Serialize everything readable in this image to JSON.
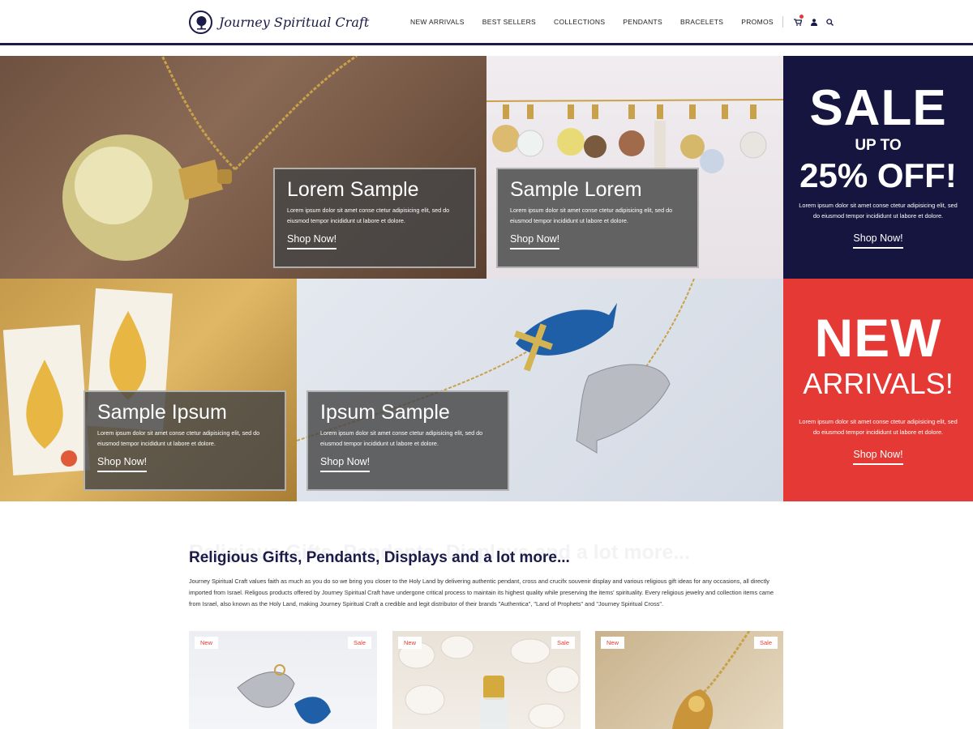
{
  "brand": {
    "name": "Journey Spiritual Craft"
  },
  "nav": {
    "items": [
      "NEW ARRIVALS",
      "BEST SELLERS",
      "COLLECTIONS",
      "PENDANTS",
      "BRACELETS",
      "PROMOS"
    ],
    "icons": [
      "cart-icon",
      "user-icon",
      "search-icon"
    ]
  },
  "banners": [
    {
      "title": "Lorem Sample",
      "text": "Lorem ipsum dolor sit amet conse ctetur adipisicing elit, sed do eiusmod tempor incididunt ut labore et dolore.",
      "link": "Shop Now!"
    },
    {
      "title": "Sample Lorem",
      "text": "Lorem ipsum dolor sit amet conse ctetur adipisicing elit, sed do eiusmod tempor incididunt ut labore et dolore.",
      "link": "Shop Now!"
    },
    {
      "title": "Sample Ipsum",
      "text": "Lorem ipsum dolor sit amet conse ctetur adipisicing elit, sed do eiusmod tempor incididunt ut labore et dolore.",
      "link": "Shop Now!"
    },
    {
      "title": "Ipsum Sample",
      "text": "Lorem ipsum dolor sit amet conse ctetur adipisicing elit, sed do eiusmod tempor incididunt ut labore et dolore.",
      "link": "Shop Now!"
    }
  ],
  "sale_promo": {
    "big": "SALE",
    "mid": "UP TO",
    "pct": "25% OFF!",
    "text": "Lorem ipsum dolor sit amet conse ctetur adipisicing elit, sed do eiusmod tempor incididunt ut labore et dolore.",
    "link": "Shop Now!",
    "color": "#15153f"
  },
  "new_promo": {
    "big": "NEW",
    "mid": "ARRIVALS!",
    "text": "Lorem ipsum dolor sit amet conse ctetur adipisicing elit, sed do eiusmod tempor incididunt ut labore et dolore.",
    "link": "Shop Now!",
    "color": "#e53935"
  },
  "intro": {
    "title": "Religious Gifts, Pendants, Displays and a lot more...",
    "text": "Journey Spiritual Craft values faith as much as you do so we bring you closer to the Holy Land by delivering authentic pendant, cross and crucifx souvenir display and various religious gift ideas for any occasions, all directly imported from Israel. Religous products offered by Journey Spiritual Craft have undergone critical process to maintain its highest quality while preserving the items' spirituality. Every religious jewelry and collection items came from Israel, also known as the Holy Land, making Journey Spiritual Craft a credible and legit distributor of their brands \"Authentica\", \"Land of Prophets\" and \"Journey Spiritual Cross\"."
  },
  "products": [
    {
      "badge_new": "New",
      "badge_sale": "Sale"
    },
    {
      "badge_new": "New",
      "badge_sale": "Sale"
    },
    {
      "badge_new": "New",
      "badge_sale": "Sale"
    }
  ]
}
